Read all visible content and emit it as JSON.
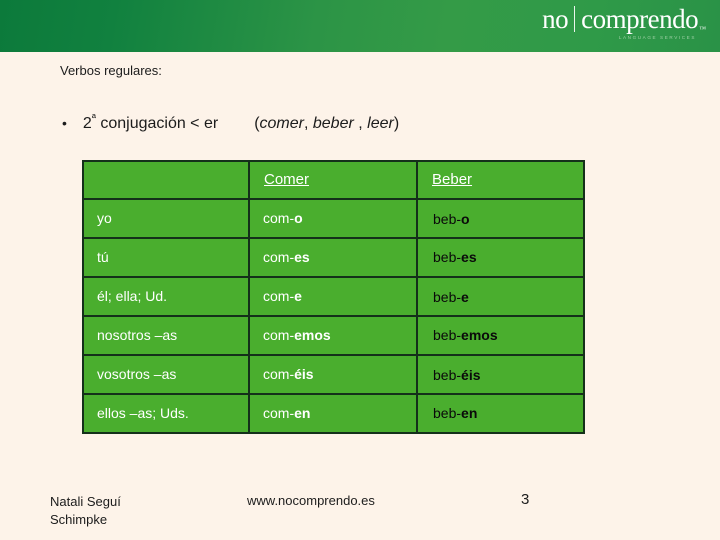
{
  "header": {
    "logo": {
      "word_one": "no",
      "divider": "|",
      "word_two": "comprendo",
      "trademark": "™",
      "tagline": "LANGUAGE SERVICES"
    },
    "gradient_from": "#0c7a3b",
    "gradient_to": "#2a9247"
  },
  "slide": {
    "subtitle": "Verbos regulares:",
    "bullet_marker": "•",
    "bullet_number": "2",
    "bullet_ordinal_suffix": "ª",
    "bullet_text": " conjugación < er",
    "examples_open": "(",
    "example_one": "comer",
    "example_sep_one": ", ",
    "example_two": "beber",
    "example_sep_two": " , ",
    "example_three": "leer",
    "examples_close": ")"
  },
  "table": {
    "headers": [
      "",
      "Comer",
      "Beber"
    ],
    "rows": [
      {
        "pronoun": "yo",
        "comer_stem": "com-",
        "comer_ending": "o",
        "beber_stem": "beb-",
        "beber_ending": "o",
        "beber_offset": "shift-small"
      },
      {
        "pronoun": "tú",
        "comer_stem": "com-",
        "comer_ending": "es",
        "beber_stem": "beb-",
        "beber_ending": "es",
        "beber_offset": "shift-none"
      },
      {
        "pronoun": "él; ella; Ud.",
        "comer_stem": "com-",
        "comer_ending": "e",
        "beber_stem": "beb-",
        "beber_ending": "e",
        "beber_offset": "shift-small"
      },
      {
        "pronoun": "nosotros –as",
        "comer_stem": "com-",
        "comer_ending": "emos",
        "beber_stem": "beb-",
        "beber_ending": "emos",
        "beber_offset": "shift-none"
      },
      {
        "pronoun": "vosotros –as",
        "comer_stem": "com-",
        "comer_ending": "éis",
        "beber_stem": "beb-",
        "beber_ending": "éis",
        "beber_offset": "shift-small"
      },
      {
        "pronoun": "ellos –as; Uds.",
        "comer_stem": "com-",
        "comer_ending": "en",
        "beber_stem": "beb-",
        "beber_ending": "en",
        "beber_offset": "shift-none"
      }
    ],
    "cell_color": "#4aae2e",
    "border_color": "#14301a"
  },
  "footer": {
    "author_line_one": "Natali Seguí",
    "author_line_two": "Schimpke",
    "website": "www.nocomprendo.es",
    "page_number": "3"
  },
  "background_color": "#fdf3e9"
}
